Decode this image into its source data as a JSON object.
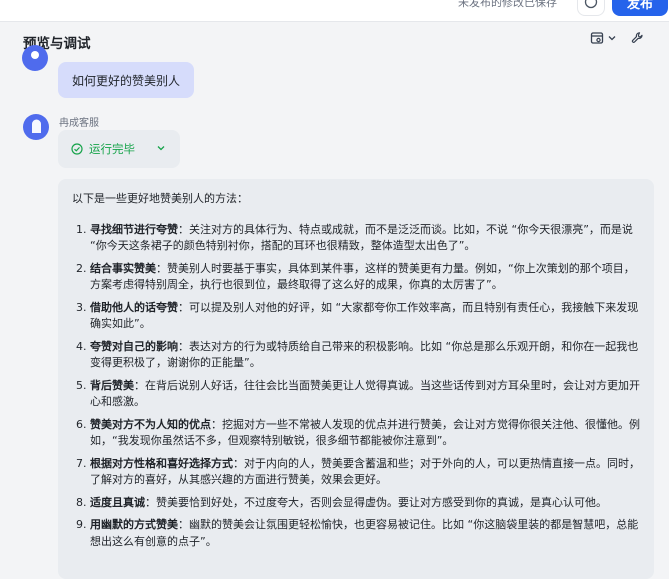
{
  "topbar": {
    "hint_text": "未发布的修改已保存",
    "publish_label": "发布"
  },
  "panel": {
    "title": "预览与调试"
  },
  "chat": {
    "user_message": "如何更好的赞美别人",
    "bot_name": "冉成客服",
    "status_label": "运行完毕",
    "answer_intro": "以下是一些更好地赞美别人的方法：",
    "items": [
      {
        "num": "1.",
        "title": "寻找细节进行夸赞",
        "text": "：关注对方的具体行为、特点或成就，而不是泛泛而谈。比如，不说 “你今天很漂亮”，而是说 “你今天这条裙子的颜色特别衬你，搭配的耳环也很精致，整体造型太出色了”。"
      },
      {
        "num": "2.",
        "title": "结合事实赞美",
        "text": "：赞美别人时要基于事实，具体到某件事，这样的赞美更有力量。例如，“你上次策划的那个项目，方案考虑得特别周全，执行也很到位，最终取得了这么好的成果，你真的太厉害了”。"
      },
      {
        "num": "3.",
        "title": "借助他人的话夸赞",
        "text": "：可以提及别人对他的好评，如 “大家都夸你工作效率高，而且特别有责任心，我接触下来发现确实如此”。"
      },
      {
        "num": "4.",
        "title": "夸赞对自己的影响",
        "text": "：表达对方的行为或特质给自己带来的积极影响。比如 “你总是那么乐观开朗，和你在一起我也变得更积极了，谢谢你的正能量”。"
      },
      {
        "num": "5.",
        "title": "背后赞美",
        "text": "：在背后说别人好话，往往会比当面赞美更让人觉得真诚。当这些话传到对方耳朵里时，会让对方更加开心和感激。"
      },
      {
        "num": "6.",
        "title": "赞美对方不为人知的优点",
        "text": "：挖掘对方一些不常被人发现的优点并进行赞美，会让对方觉得你很关注他、很懂他。例如，“我发现你虽然话不多，但观察特别敏锐，很多细节都能被你注意到”。"
      },
      {
        "num": "7.",
        "title": "根据对方性格和喜好选择方式",
        "text": "：对于内向的人，赞美要含蓄温和些；对于外向的人，可以更热情直接一点。同时，了解对方的喜好，从其感兴趣的方面进行赞美，效果会更好。"
      },
      {
        "num": "8.",
        "title": "适度且真诚",
        "text": "：赞美要恰到好处，不过度夸大，否则会显得虚伪。要让对方感受到你的真诚，是真心认可他。"
      },
      {
        "num": "9.",
        "title": "用幽默的方式赞美",
        "text": "：幽默的赞美会让氛围更轻松愉快，也更容易被记住。比如 “你这脑袋里装的都是智慧吧，总能想出这么有创意的点子”。"
      }
    ]
  },
  "colors": {
    "accent": "#2563eb",
    "user_bubble": "#d6dcfb",
    "success": "#16a34a",
    "bubble_bg": "#e9ecf0"
  },
  "icons": {
    "display_settings": "display-settings-icon",
    "chevron": "chevron-down-icon",
    "wrench": "wrench-icon",
    "success": "check-circle-icon",
    "avatar": "bot-avatar-icon"
  }
}
